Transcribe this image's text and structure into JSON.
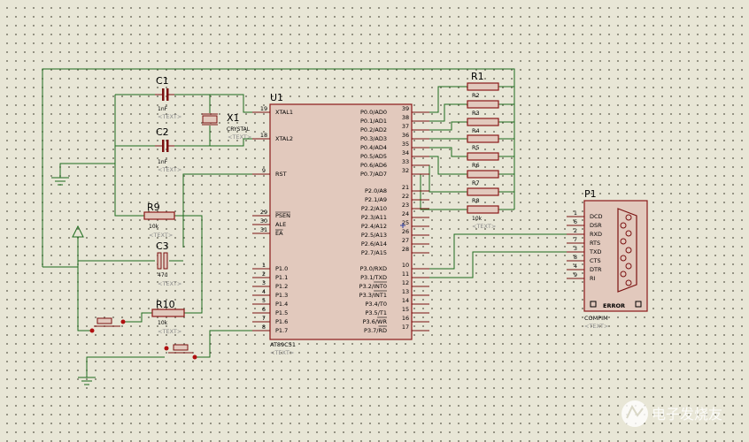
{
  "mcu": {
    "ref": "U1",
    "part": "AT89C51",
    "text_tag": "<TEXT>",
    "left_pins": [
      {
        "num": "19",
        "name": "XTAL1",
        "bar": false
      },
      {
        "num": "18",
        "name": "XTAL2",
        "bar": false
      },
      {
        "num": "9",
        "name": "RST",
        "bar": false
      },
      {
        "num": "29",
        "name": "PSEN",
        "bar": true
      },
      {
        "num": "30",
        "name": "ALE",
        "bar": false
      },
      {
        "num": "31",
        "name": "EA",
        "bar": true
      },
      {
        "num": "1",
        "name": "P1.0",
        "bar": false
      },
      {
        "num": "2",
        "name": "P1.1",
        "bar": false
      },
      {
        "num": "3",
        "name": "P1.2",
        "bar": false
      },
      {
        "num": "4",
        "name": "P1.3",
        "bar": false
      },
      {
        "num": "5",
        "name": "P1.4",
        "bar": false
      },
      {
        "num": "6",
        "name": "P1.5",
        "bar": false
      },
      {
        "num": "7",
        "name": "P1.6",
        "bar": false
      },
      {
        "num": "8",
        "name": "P1.7",
        "bar": false
      }
    ],
    "right_pins": [
      {
        "num": "39",
        "name": "P0.0/AD0",
        "bar": false
      },
      {
        "num": "38",
        "name": "P0.1/AD1",
        "bar": false
      },
      {
        "num": "37",
        "name": "P0.2/AD2",
        "bar": false
      },
      {
        "num": "36",
        "name": "P0.3/AD3",
        "bar": false
      },
      {
        "num": "35",
        "name": "P0.4/AD4",
        "bar": false
      },
      {
        "num": "34",
        "name": "P0.5/AD5",
        "bar": false
      },
      {
        "num": "33",
        "name": "P0.6/AD6",
        "bar": false
      },
      {
        "num": "32",
        "name": "P0.7/AD7",
        "bar": false
      },
      {
        "num": "21",
        "name": "P2.0/A8",
        "bar": false
      },
      {
        "num": "22",
        "name": "P2.1/A9",
        "bar": false
      },
      {
        "num": "23",
        "name": "P2.2/A10",
        "bar": false
      },
      {
        "num": "24",
        "name": "P2.3/A11",
        "bar": false
      },
      {
        "num": "25",
        "name": "P2.4/A12",
        "bar": false
      },
      {
        "num": "26",
        "name": "P2.5/A13",
        "bar": false
      },
      {
        "num": "27",
        "name": "P2.6/A14",
        "bar": false
      },
      {
        "num": "28",
        "name": "P2.7/A15",
        "bar": false
      },
      {
        "num": "10",
        "name": "P3.0/RXD",
        "bar": false
      },
      {
        "num": "11",
        "name": "P3.1/TXD",
        "bar": false
      },
      {
        "num": "12",
        "name": "P3.2/INT0",
        "bar": true
      },
      {
        "num": "13",
        "name": "P3.3/INT1",
        "bar": true
      },
      {
        "num": "14",
        "name": "P3.4/T0",
        "bar": false
      },
      {
        "num": "15",
        "name": "P3.5/T1",
        "bar": false
      },
      {
        "num": "16",
        "name": "P3.6/WR",
        "bar": true
      },
      {
        "num": "17",
        "name": "P3.7/RD",
        "bar": true
      }
    ]
  },
  "c1": {
    "ref": "C1",
    "value": "1nF",
    "text_tag": "<TEXT>"
  },
  "c2": {
    "ref": "C2",
    "value": "1nF",
    "text_tag": "<TEXT>"
  },
  "x1": {
    "ref": "X1",
    "value": "CRYSTAL",
    "text_tag": "<TEXT>"
  },
  "r9": {
    "ref": "R9",
    "value": "10k",
    "text_tag": "<TEXT>"
  },
  "c3": {
    "ref": "C3",
    "value": "47u",
    "text_tag": "<TEXT>"
  },
  "r10": {
    "ref": "R10",
    "value": "10k",
    "text_tag": "<TEXT>"
  },
  "rpack": {
    "ref": "R1",
    "value": "10k",
    "text_tag": "<TEXT>",
    "labels": [
      "R2",
      "R3",
      "R4",
      "R5",
      "R6",
      "R7",
      "R8"
    ]
  },
  "p1": {
    "ref": "P1",
    "part": "COMPIM",
    "text_tag": "<TEXT>",
    "error": "ERROR",
    "pins": [
      {
        "num": "1",
        "name": "DCD"
      },
      {
        "num": "6",
        "name": "DSR"
      },
      {
        "num": "2",
        "name": "RXD"
      },
      {
        "num": "7",
        "name": "RTS"
      },
      {
        "num": "3",
        "name": "TXD"
      },
      {
        "num": "8",
        "name": "CTS"
      },
      {
        "num": "4",
        "name": "DTR"
      },
      {
        "num": "9",
        "name": "RI"
      }
    ]
  },
  "watermark": "电子发烧友"
}
